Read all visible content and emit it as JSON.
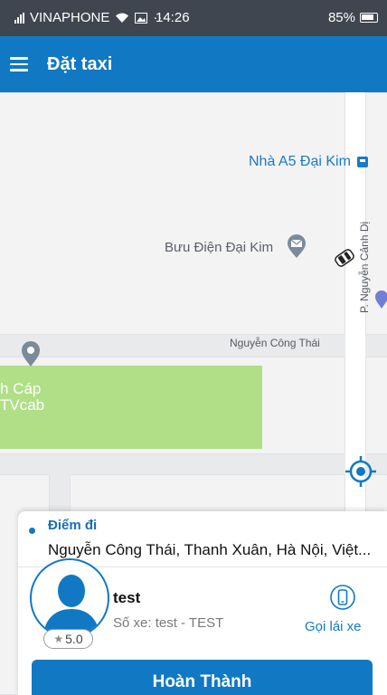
{
  "status_bar": {
    "carrier": "VINAPHONE",
    "more": "···",
    "time": "14:26",
    "battery": "85%"
  },
  "app_bar": {
    "title": "Đặt taxi"
  },
  "map": {
    "labels": {
      "building": "Nhà A5 Đại Kim",
      "post_office": "Bưu Điện Đại Kim",
      "street_nct": "Nguyễn Công Thái",
      "street_ncd": "P. Nguyễn Cảnh Dị",
      "cable_line1": "h Cáp",
      "cable_line2": "TVcab"
    },
    "colors": {
      "road": "#ffffff",
      "park": "#b1df87",
      "poi_blue": "#1b79c6"
    }
  },
  "trip": {
    "pickup_label": "Điểm đi",
    "pickup_address": "Nguyễn Công Thái, Thanh Xuân, Hà Nội, Việt..."
  },
  "driver": {
    "name": "test",
    "plate": "Số xe: test - TEST",
    "rating": "5.0",
    "call_label": "Gọi lái xe"
  },
  "actions": {
    "finish_label": "Hoàn Thành"
  },
  "theme": {
    "primary": "#1178c4",
    "status_bar": "#3f4650"
  }
}
